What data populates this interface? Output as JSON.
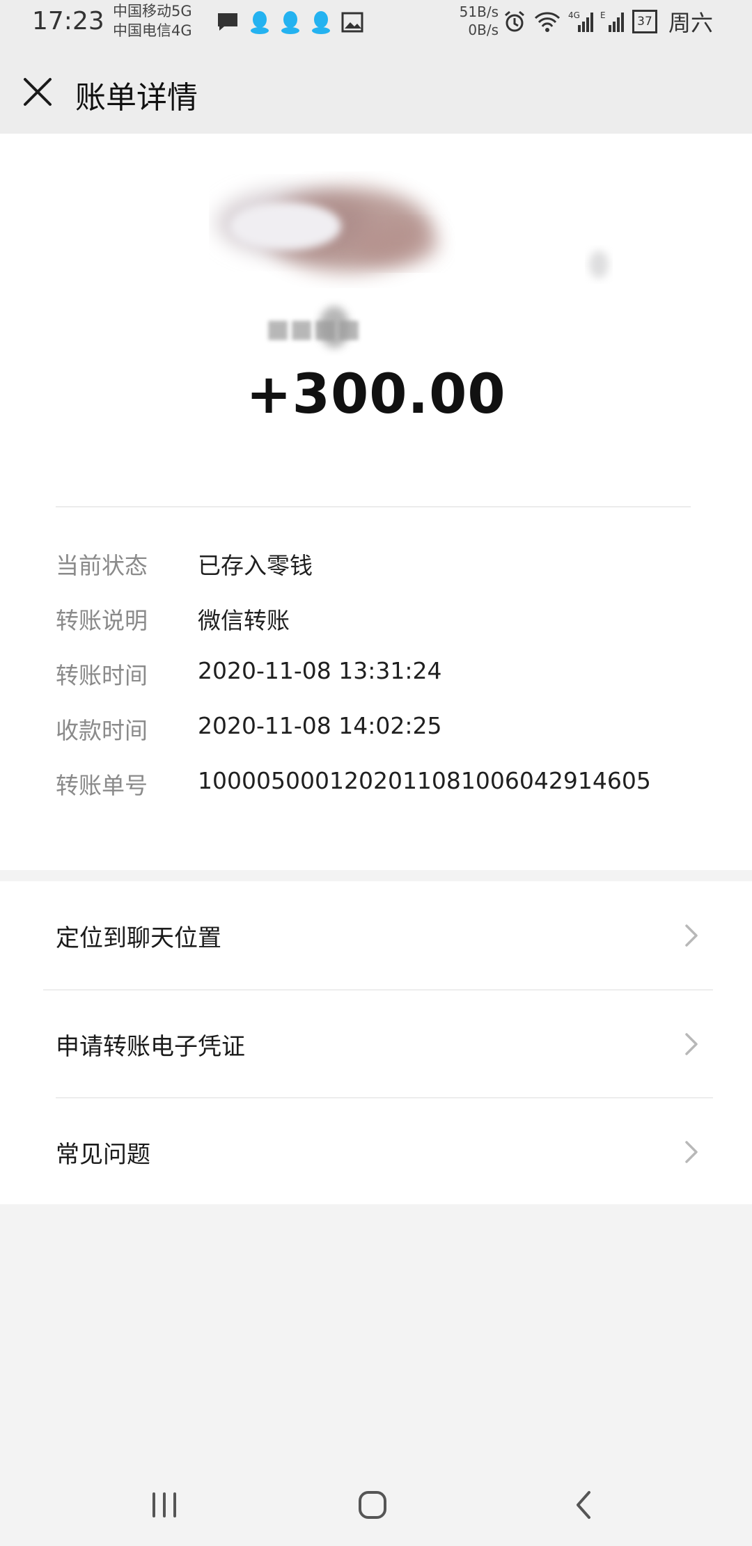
{
  "status_bar": {
    "time": "17:23",
    "carrier_1": "中国移动5G",
    "carrier_2": "中国电信4G",
    "net_up": "51B/s",
    "net_down": "0B/s",
    "battery": "37",
    "day": "周六"
  },
  "header": {
    "title": "账单详情"
  },
  "transfer": {
    "amount": "+300.00"
  },
  "details": [
    {
      "label": "当前状态",
      "value": "已存入零钱"
    },
    {
      "label": "转账说明",
      "value": "微信转账"
    },
    {
      "label": "转账时间",
      "value": "2020-11-08 13:31:24"
    },
    {
      "label": "收款时间",
      "value": "2020-11-08 14:02:25"
    },
    {
      "label": "转账单号",
      "value": "1000050001202011081006042914605"
    }
  ],
  "actions": [
    {
      "label": "定位到聊天位置"
    },
    {
      "label": "申请转账电子凭证"
    },
    {
      "label": "常见问题"
    }
  ],
  "colors": {
    "background": "#f3f3f3",
    "header_bg": "#ededed",
    "card_bg": "#ffffff",
    "label_gray": "#8a8a8a",
    "qq_blue": "#24b2f0"
  },
  "icons": {
    "close": "close-icon",
    "chevron": "chevron-right-icon",
    "nav_recents": "recents-icon",
    "nav_home": "home-icon",
    "nav_back": "back-icon"
  }
}
